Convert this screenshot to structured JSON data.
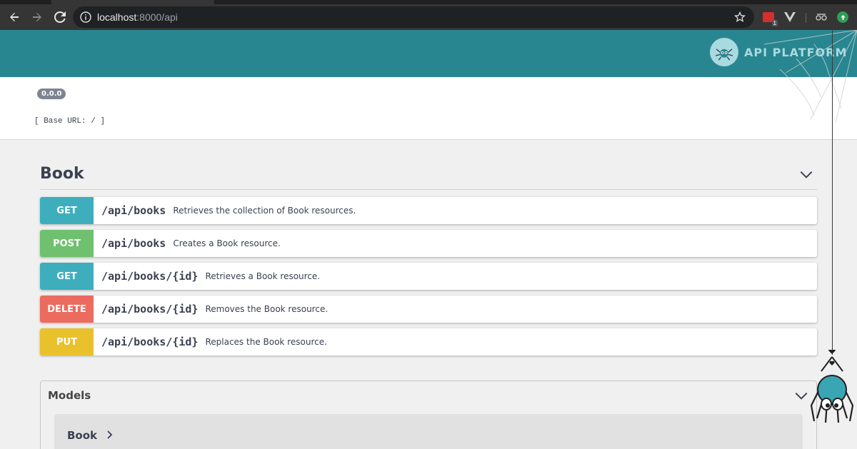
{
  "browser": {
    "url_host": "localhost",
    "url_path": ":8000/api",
    "ext_badge": "1"
  },
  "header": {
    "logo_text": "API PLATFORM"
  },
  "info": {
    "version": "0.0.0",
    "base_url": "[ Base URL: / ]"
  },
  "tag": {
    "name": "Book"
  },
  "operations": [
    {
      "method": "GET",
      "path": "/api/books",
      "summary": "Retrieves the collection of Book resources.",
      "color": "#3eaebd"
    },
    {
      "method": "POST",
      "path": "/api/books",
      "summary": "Creates a Book resource.",
      "color": "#6fc06f"
    },
    {
      "method": "GET",
      "path": "/api/books/{id}",
      "summary": "Retrieves a Book resource.",
      "color": "#3eaebd"
    },
    {
      "method": "DELETE",
      "path": "/api/books/{id}",
      "summary": "Removes the Book resource.",
      "color": "#ec6b5f"
    },
    {
      "method": "PUT",
      "path": "/api/books/{id}",
      "summary": "Replaces the Book resource.",
      "color": "#e9c12d"
    }
  ],
  "models": {
    "title": "Models",
    "items": [
      {
        "name": "Book"
      }
    ]
  },
  "colors": {
    "header_bg": "#288690",
    "get": "#3eaebd",
    "post": "#6fc06f",
    "delete": "#ec6b5f",
    "put": "#e9c12d"
  },
  "icons": [
    "back-icon",
    "forward-icon",
    "reload-icon",
    "info-icon",
    "star-icon",
    "chevron-down-icon",
    "chevron-right-icon",
    "spider-logo-icon"
  ]
}
